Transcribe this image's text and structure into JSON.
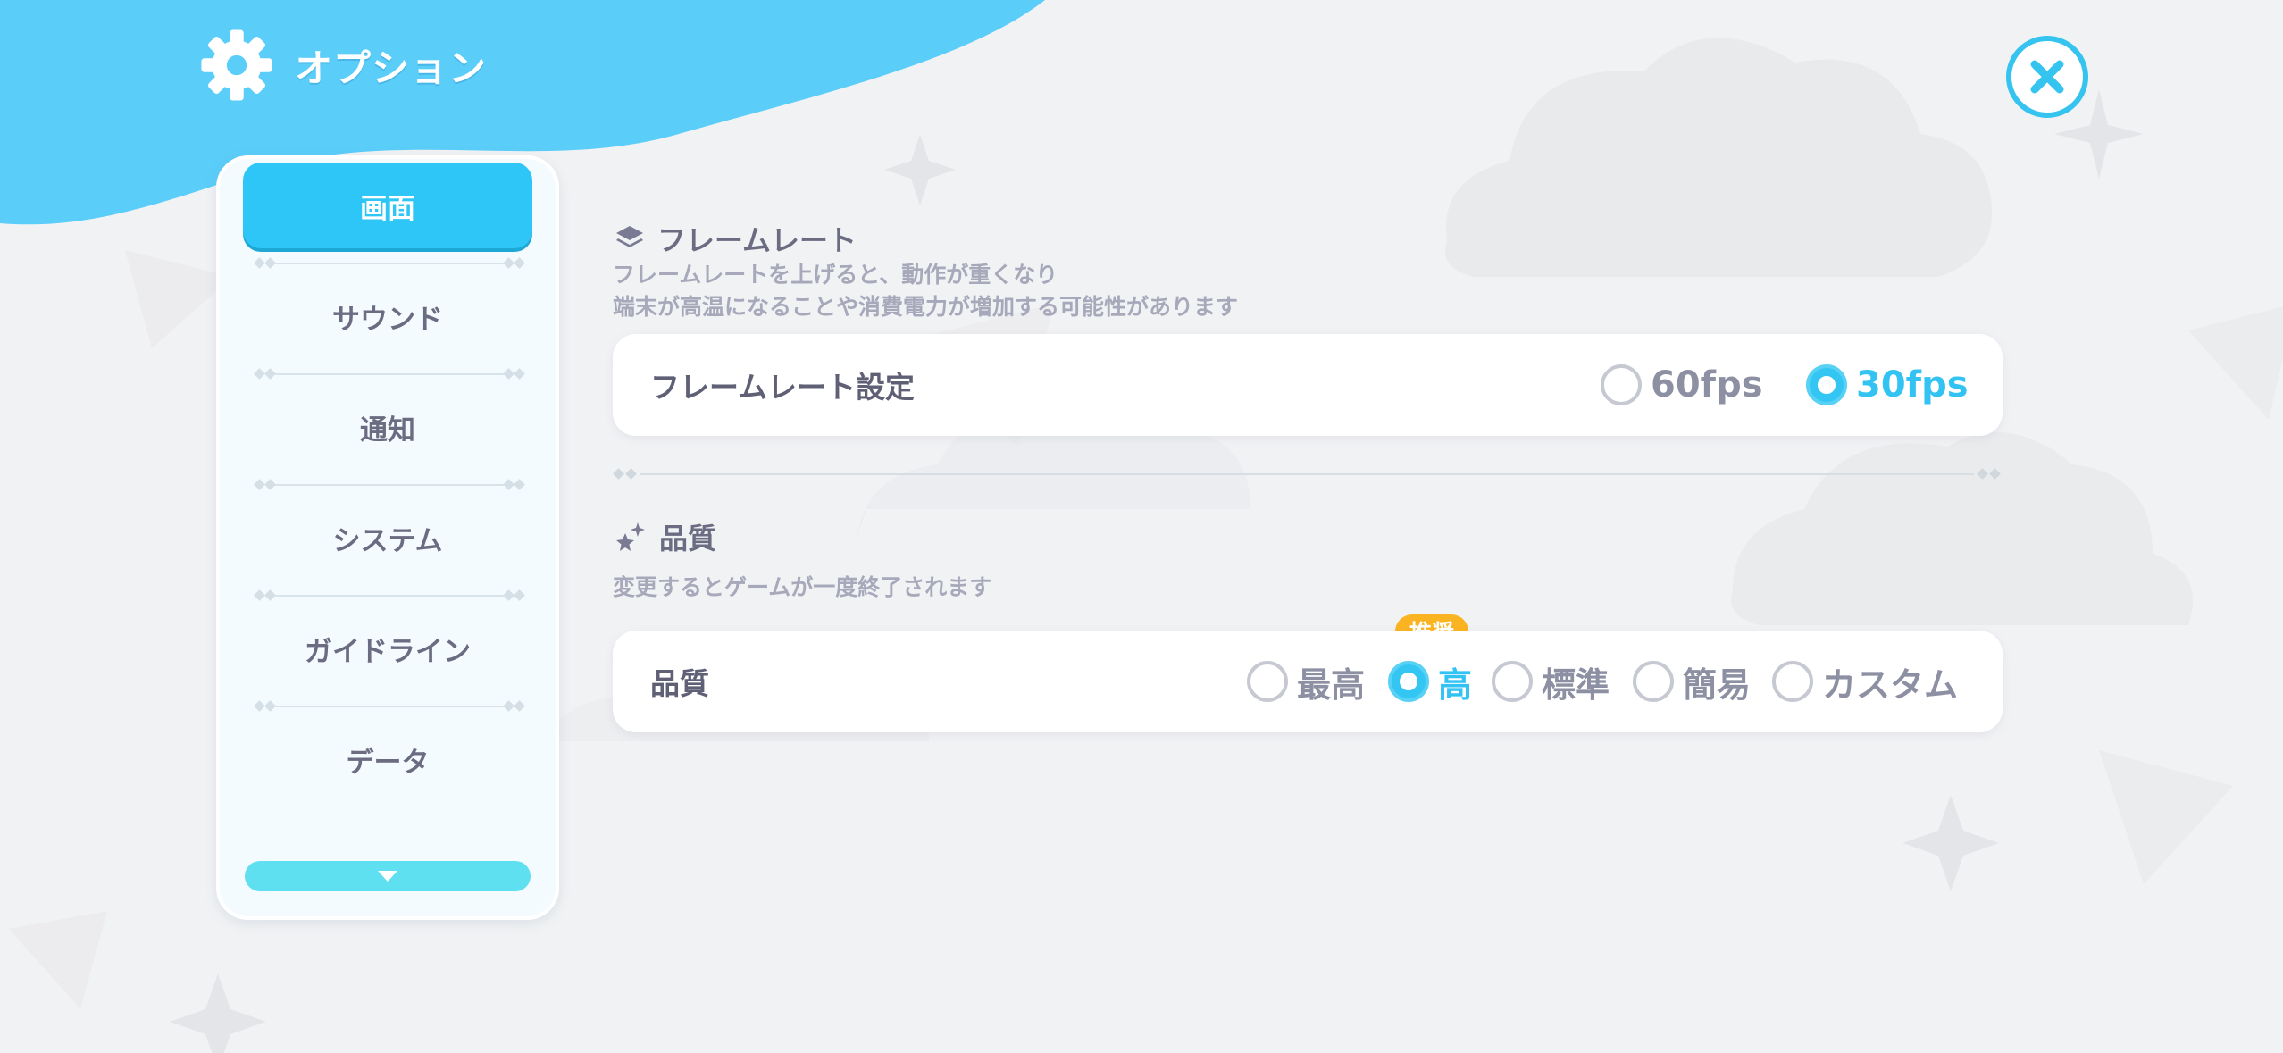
{
  "header": {
    "title": "オプション"
  },
  "sidebar": {
    "items": [
      {
        "label": "画面",
        "active": true
      },
      {
        "label": "サウンド"
      },
      {
        "label": "通知"
      },
      {
        "label": "システム"
      },
      {
        "label": "ガイドライン"
      },
      {
        "label": "データ"
      }
    ]
  },
  "framerate": {
    "section_title": "フレームレート",
    "desc_line1": "フレームレートを上げると、動作が重くなり",
    "desc_line2": "端末が高温になることや消費電力が増加する可能性があります",
    "setting_label": "フレームレート設定",
    "options": [
      {
        "label": "60fps",
        "selected": false
      },
      {
        "label": "30fps",
        "selected": true
      }
    ]
  },
  "quality": {
    "section_title": "品質",
    "desc": "変更するとゲームが一度終了されます",
    "setting_label": "品質",
    "recommended_badge": "推奨",
    "options": [
      {
        "label": "最高",
        "selected": false
      },
      {
        "label": "高",
        "selected": true
      },
      {
        "label": "標準",
        "selected": false
      },
      {
        "label": "簡易",
        "selected": false
      },
      {
        "label": "カスタム",
        "selected": false
      }
    ]
  },
  "colors": {
    "accent": "#2ec6f6",
    "header": "#5acdf9",
    "badge": "#fbb421",
    "background": "#f1f2f4"
  }
}
